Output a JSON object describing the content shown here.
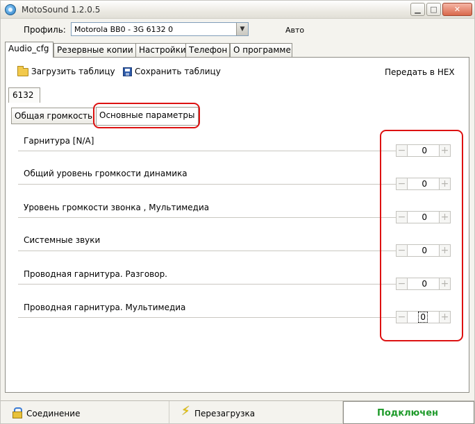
{
  "window": {
    "title": "MotoSound 1.2.0.5"
  },
  "profile": {
    "label": "Профиль:",
    "value": "Motorola BB0 -  3G 6132 0",
    "auto_label": "Авто"
  },
  "tabs": [
    {
      "label": "Audio_cfg",
      "active": true
    },
    {
      "label": "Резервные копии",
      "active": false
    },
    {
      "label": "Настройки",
      "active": false
    },
    {
      "label": "Телефон",
      "active": false
    },
    {
      "label": "О программе",
      "active": false
    }
  ],
  "toolbar": {
    "load_label": "Загрузить таблицу",
    "save_label": "Сохранить таблицу",
    "hex_label": "Передать в HEX"
  },
  "model": "6132",
  "subtabs": {
    "general": "Общая громкость",
    "main": "Основные параметры"
  },
  "params": [
    {
      "label": "Гарнитура [N/A]",
      "value": "0"
    },
    {
      "label": "Общий уровень громкости динамика",
      "value": "0"
    },
    {
      "label": "Уровень громкости звонка , Мультимедиа",
      "value": "0"
    },
    {
      "label": "Системные звуки",
      "value": "0"
    },
    {
      "label": "Проводная гарнитура. Разговор.",
      "value": "0"
    },
    {
      "label": "Проводная гарнитура. Мультимедиа",
      "value": "0"
    }
  ],
  "stepper_symbols": {
    "minus": "−",
    "plus": "+"
  },
  "statusbar": {
    "connection": "Соединение",
    "reboot": "Перезагрузка",
    "state": "Подключен"
  },
  "colors": {
    "highlight": "#dd1111",
    "connected": "#1e9a2a"
  }
}
